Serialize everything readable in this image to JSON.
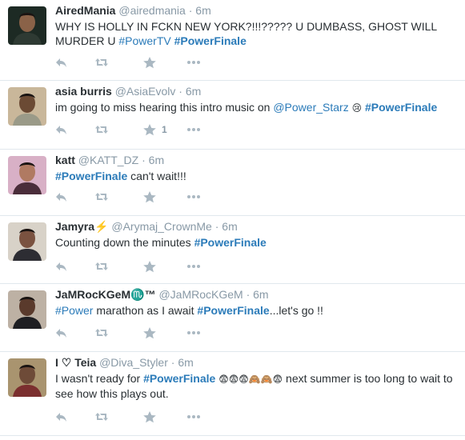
{
  "tweets": [
    {
      "name": "AiredMania",
      "handle": "@airedmania",
      "time": "6m",
      "parts": [
        {
          "t": "text",
          "v": "WHY IS HOLLY IN FCKN NEW YORK?!!!????? U DUMBASS, GHOST WILL MURDER U "
        },
        {
          "t": "tag",
          "v": "#PowerTV"
        },
        {
          "t": "text",
          "v": " "
        },
        {
          "t": "tagb",
          "v": "#PowerFinale"
        }
      ],
      "favorite_count": ""
    },
    {
      "name": "asia burris",
      "handle": "@AsiaEvolv",
      "time": "6m",
      "parts": [
        {
          "t": "text",
          "v": "im going to miss hearing this intro music on "
        },
        {
          "t": "tag",
          "v": "@Power_Starz"
        },
        {
          "t": "text",
          "v": " "
        },
        {
          "t": "emoji",
          "v": "😢"
        },
        {
          "t": "text",
          "v": " "
        },
        {
          "t": "tagb",
          "v": "#PowerFinale"
        }
      ],
      "favorite_count": "1"
    },
    {
      "name": "katt",
      "handle": "@KATT_DZ",
      "time": "6m",
      "parts": [
        {
          "t": "tagb",
          "v": "#PowerFinale"
        },
        {
          "t": "text",
          "v": " can't wait!!!"
        }
      ],
      "favorite_count": ""
    },
    {
      "name": "Jamyra⚡",
      "handle": "@Arymaj_CrownMe",
      "time": "6m",
      "parts": [
        {
          "t": "text",
          "v": "Counting down the minutes "
        },
        {
          "t": "tagb",
          "v": "#PowerFinale"
        }
      ],
      "favorite_count": ""
    },
    {
      "name": "JaMRocKGeM♏™",
      "handle": "@JaMRocKGeM",
      "time": "6m",
      "parts": [
        {
          "t": "tag",
          "v": "#Power"
        },
        {
          "t": "text",
          "v": " marathon as I await "
        },
        {
          "t": "tagb",
          "v": "#PowerFinale"
        },
        {
          "t": "text",
          "v": "...let's go !!"
        }
      ],
      "favorite_count": ""
    },
    {
      "name": "I ♡ Teia",
      "handle": "@Diva_Styler",
      "time": "6m",
      "parts": [
        {
          "t": "text",
          "v": "I wasn't ready for "
        },
        {
          "t": "tagb",
          "v": "#PowerFinale"
        },
        {
          "t": "text",
          "v": " "
        },
        {
          "t": "emoji",
          "v": "😨😨😨🙈🙈😨"
        },
        {
          "t": "text",
          "v": " next summer is too long to wait to see how this plays out."
        }
      ],
      "favorite_count": ""
    }
  ],
  "colors": {
    "link": "#2b7bb9",
    "meta": "#8899a6",
    "icon": "#aab8c2",
    "divider": "#e1e8ed"
  },
  "icons": [
    "reply-icon",
    "retweet-icon",
    "favorite-icon",
    "more-icon"
  ]
}
